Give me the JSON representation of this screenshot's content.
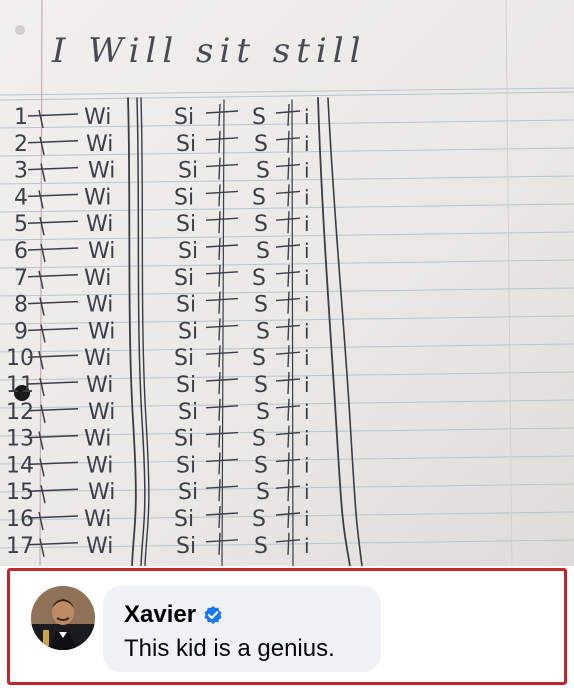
{
  "photo": {
    "header_text": "I Will sit still",
    "rows": [
      "1",
      "2",
      "3",
      "4",
      "5",
      "6",
      "7",
      "8",
      "9",
      "10",
      "11",
      "12",
      "13",
      "14",
      "15",
      "16",
      "17"
    ],
    "col_w": "Wi",
    "col_s": "Si",
    "col_st": "S",
    "col_i": "i"
  },
  "comment": {
    "author": "Xavier",
    "text": "This kid is a genius.",
    "verified_icon": "verified-badge-icon",
    "accent_color": "#1877f2",
    "frame_color": "#c2252b"
  }
}
